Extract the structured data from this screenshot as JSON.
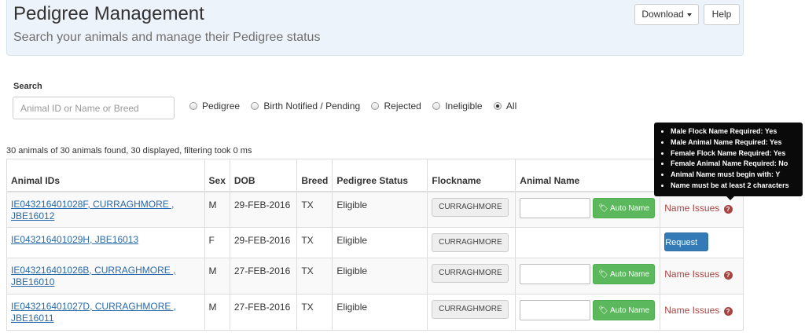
{
  "header": {
    "title": "Pedigree Management",
    "subtitle": "Search your animals and manage their Pedigree status",
    "download_label": "Download",
    "help_label": "Help"
  },
  "search": {
    "label": "Search",
    "placeholder": "Animal ID or Name or Breed",
    "value": ""
  },
  "filters": {
    "options": [
      {
        "label": "Pedigree",
        "checked": false
      },
      {
        "label": "Birth Notified / Pending",
        "checked": false
      },
      {
        "label": "Rejected",
        "checked": false
      },
      {
        "label": "Ineligible",
        "checked": false
      },
      {
        "label": "All",
        "checked": true
      }
    ]
  },
  "results_text": "30 animals of 30 animals found, 30 displayed, filtering took 0 ms",
  "table": {
    "columns": [
      "Animal IDs",
      "Sex",
      "DOB",
      "Breed",
      "Pedigree Status",
      "Flockname",
      "Animal Name",
      ""
    ],
    "rows": [
      {
        "id_line1": "IE043216401028F, CURRAGHMORE ,",
        "id_line2": "JBE16012",
        "sex": "M",
        "dob": "29-FEB-2016",
        "breed": "TX",
        "status": "Eligible",
        "flockname": "CURRAGHMORE",
        "auto_name_label": "Auto Name",
        "action": "Name Issues"
      },
      {
        "id_line1": "IE043216401029H, JBE16013",
        "id_line2": "",
        "sex": "F",
        "dob": "29-FEB-2016",
        "breed": "TX",
        "status": "Eligible",
        "flockname": "CURRAGHMORE",
        "action": "Request"
      },
      {
        "id_line1": "IE043216401026B, CURRAGHMORE ,",
        "id_line2": "JBE16010",
        "sex": "M",
        "dob": "27-FEB-2016",
        "breed": "TX",
        "status": "Eligible",
        "flockname": "CURRAGHMORE",
        "auto_name_label": "Auto Name",
        "action": "Name Issues"
      },
      {
        "id_line1": "IE043216401027D, CURRAGHMORE ,",
        "id_line2": "JBE16011",
        "sex": "M",
        "dob": "27-FEB-2016",
        "breed": "TX",
        "status": "Eligible",
        "flockname": "CURRAGHMORE",
        "auto_name_label": "Auto Name",
        "action": "Name Issues"
      }
    ]
  },
  "tooltip": {
    "items": [
      "Male Flock Name Required: Yes",
      "Male Animal Name Required: Yes",
      "Female Flock Name Required: Yes",
      "Female Animal Name Required: No",
      "Animal Name must begin with: Y",
      "Name must be at least 2 characters"
    ]
  },
  "icons": {
    "caret": "caret-down-icon",
    "tag": "tag-icon",
    "question": "question-circle-icon"
  },
  "colors": {
    "header_bg": "#ecf3fa",
    "auto_name_green": "#5cb85c",
    "request_blue": "#337ab7",
    "issues_red": "#a94442",
    "link_blue": "#2a6aa8"
  }
}
